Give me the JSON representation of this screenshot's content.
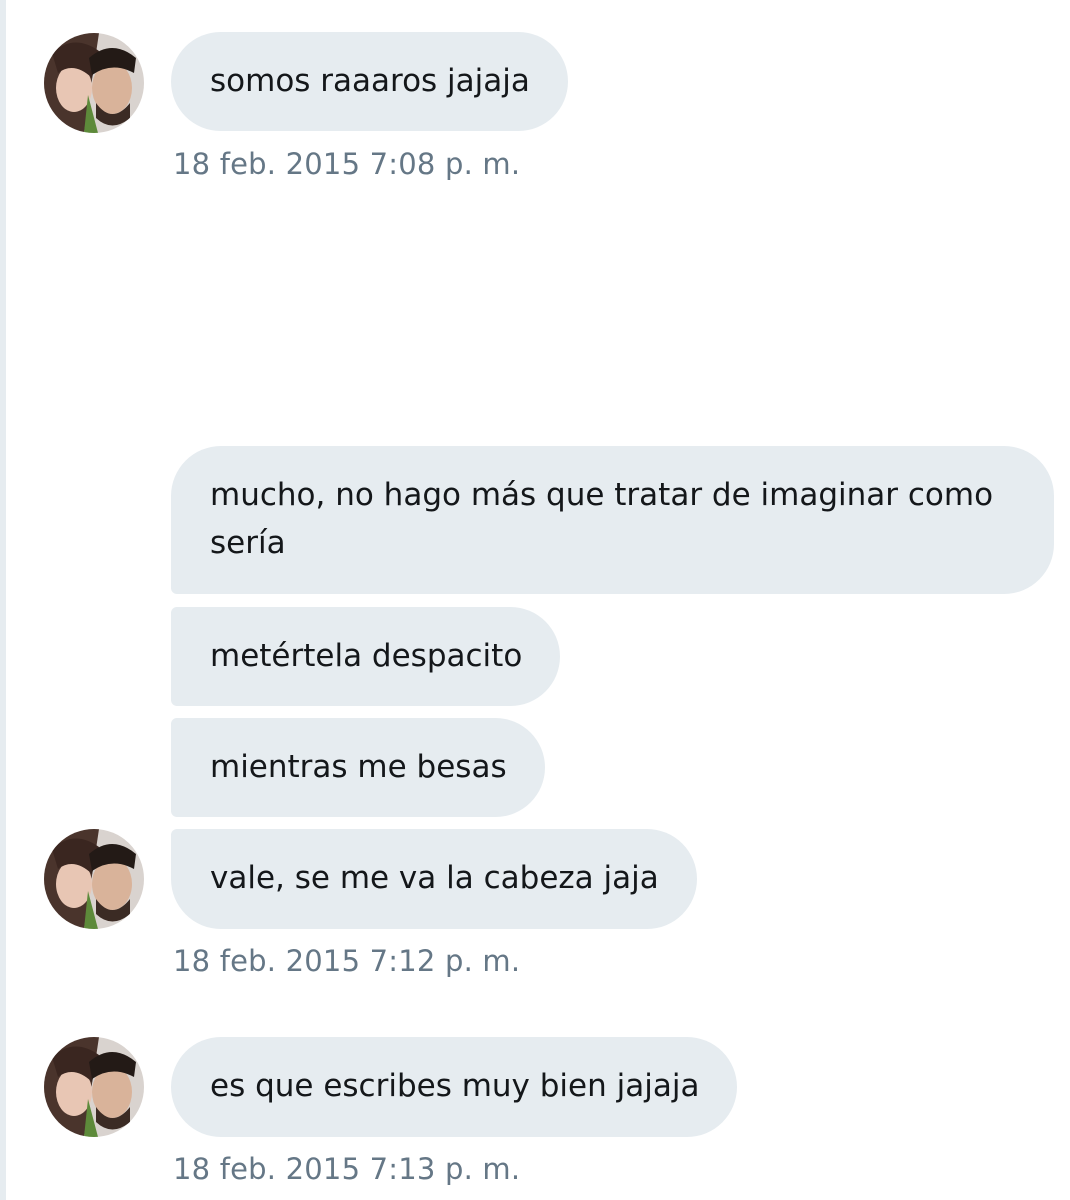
{
  "conversation": {
    "messages": [
      {
        "text": "somos raaaros jajaja",
        "timestamp": "18 feb. 2015 7:08 p. m."
      },
      {
        "text": "mucho, no hago más que tratar de imaginar como sería"
      },
      {
        "text": "metértela despacito"
      },
      {
        "text": "mientras me besas"
      },
      {
        "text": "vale, se me va la cabeza jaja",
        "timestamp": "18 feb. 2015 7:12 p. m."
      },
      {
        "text": "es que escribes muy bien jajaja",
        "timestamp": "18 feb. 2015 7:13 p. m."
      }
    ]
  },
  "colors": {
    "bubble_background": "#e6ecf0",
    "message_text": "#14171a",
    "timestamp_text": "#657786"
  },
  "icons": {
    "avatar": "avatar-photo"
  }
}
